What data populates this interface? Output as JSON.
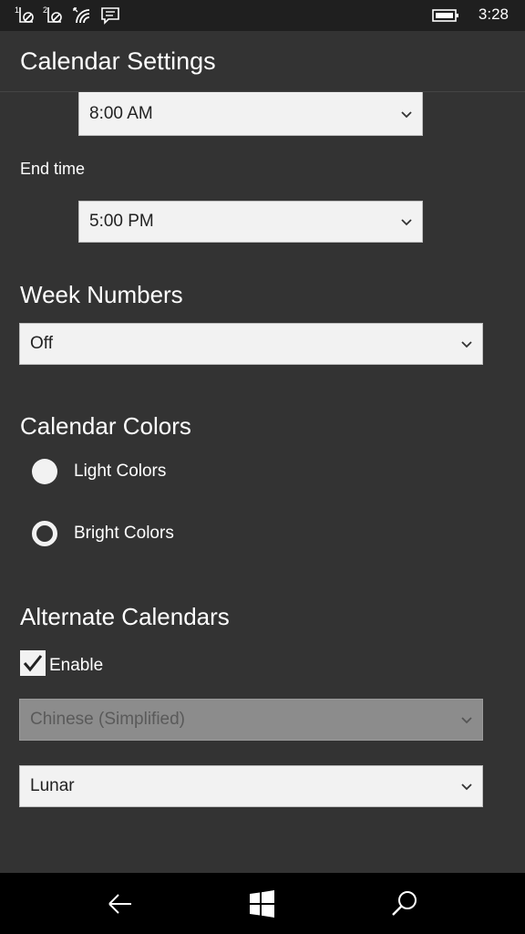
{
  "status": {
    "time": "3:28",
    "icons": [
      "sim1-no-signal-icon",
      "sim2-no-signal-icon",
      "wifi-icon",
      "message-icon",
      "battery-icon"
    ]
  },
  "title": "Calendar Settings",
  "start_time": {
    "value": "8:00 AM"
  },
  "end_time": {
    "label": "End time",
    "value": "5:00 PM"
  },
  "week_numbers": {
    "heading": "Week Numbers",
    "value": "Off"
  },
  "calendar_colors": {
    "heading": "Calendar Colors",
    "options": [
      {
        "label": "Light Colors",
        "selected": false
      },
      {
        "label": "Bright Colors",
        "selected": true
      }
    ]
  },
  "alternate_calendars": {
    "heading": "Alternate Calendars",
    "enable_label": "Enable",
    "enabled": true,
    "language_value": "Chinese (Simplified)",
    "calendar_value": "Lunar"
  },
  "nav": {
    "icons": [
      "back-icon",
      "windows-start-icon",
      "search-icon"
    ]
  },
  "colors": {
    "background": "#333333",
    "statusbar": "#1f1f1f",
    "navbar": "#000000",
    "control": "#f2f2f2",
    "disabled": "#8c8c8c"
  }
}
